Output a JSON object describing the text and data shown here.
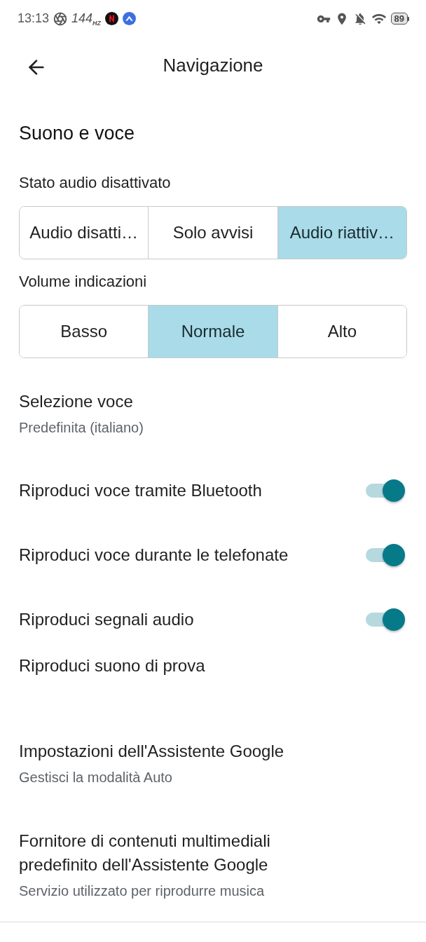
{
  "status_bar": {
    "time": "13:13",
    "refresh_rate": "144",
    "refresh_unit": "HZ",
    "battery": "89"
  },
  "header": {
    "title": "Navigazione"
  },
  "section": {
    "title": "Suono e voce"
  },
  "mute_state": {
    "label": "Stato audio disattivato",
    "options": [
      {
        "label": "Audio disatti…",
        "selected": false
      },
      {
        "label": "Solo avvisi",
        "selected": false
      },
      {
        "label": "Audio riattiv…",
        "selected": true
      }
    ]
  },
  "guidance_volume": {
    "label": "Volume indicazioni",
    "options": [
      {
        "label": "Basso",
        "selected": false
      },
      {
        "label": "Normale",
        "selected": true
      },
      {
        "label": "Alto",
        "selected": false
      }
    ]
  },
  "settings": [
    {
      "kind": "link",
      "title": "Selezione voce",
      "subtitle": "Predefinita (italiano)"
    },
    {
      "kind": "toggle",
      "title": "Riproduci voce tramite Bluetooth",
      "on": true
    },
    {
      "kind": "toggle",
      "title": "Riproduci voce durante le telefonate",
      "on": true
    },
    {
      "kind": "toggle",
      "title": "Riproduci segnali audio",
      "on": true
    },
    {
      "kind": "action",
      "title": "Riproduci suono di prova"
    },
    {
      "kind": "link",
      "title": "Impostazioni dell'Assistente Google",
      "subtitle": "Gestisci la modalità Auto"
    },
    {
      "kind": "link",
      "title": "Fornitore di contenuti multimediali predefinito dell'Assistente Google",
      "subtitle": "Servizio utilizzato per riprodurre musica"
    }
  ]
}
